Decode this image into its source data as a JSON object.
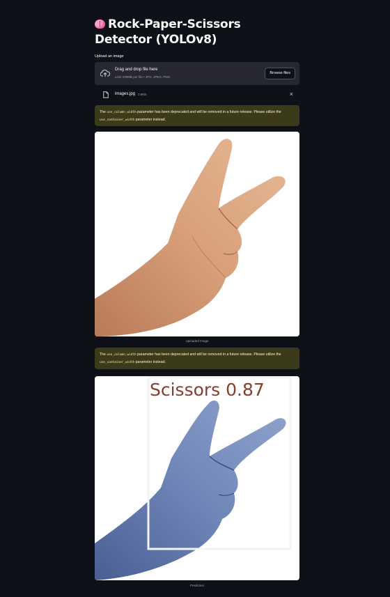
{
  "app": {
    "title": "Rock-Paper-Scissors Detector (YOLOv8)",
    "title_icon": "brain-emoji"
  },
  "uploader": {
    "label": "Upload an image",
    "drop_title": "Drag and drop file here",
    "drop_subtitle": "Limit 200MB per file • JPG, JPEG, PNG",
    "browse_label": "Browse files",
    "icon": "cloud-upload-icon"
  },
  "uploaded_file": {
    "name": "images.jpg",
    "size": "3.6KB",
    "icon": "file-icon",
    "remove_icon": "close-icon",
    "remove_glyph": "×"
  },
  "warnings": [
    {
      "pre": "The ",
      "code1": "use_column_width",
      "mid": " parameter has been deprecated and will be removed in a future release. Please utilize the ",
      "code2": "use_container_width",
      "post": " parameter instead."
    },
    {
      "pre": "The ",
      "code1": "use_column_width",
      "mid": " parameter has been deprecated and will be removed in a future release. Please utilize the ",
      "code2": "use_container_width",
      "post": " parameter instead."
    }
  ],
  "images": {
    "uploaded_caption": "Uploaded Image",
    "prediction_caption": "Prediction",
    "detection_label": "Scissors 0.87"
  },
  "colors": {
    "background": "#0e1117",
    "panel": "#262730",
    "warning_bg": "#3b3b1c",
    "warning_text": "#fff9c4",
    "skin": "#d9a27c",
    "skin_pred": "#6f86b8",
    "box_color": "#f3f3f3",
    "label_color": "#8a3c2e"
  }
}
